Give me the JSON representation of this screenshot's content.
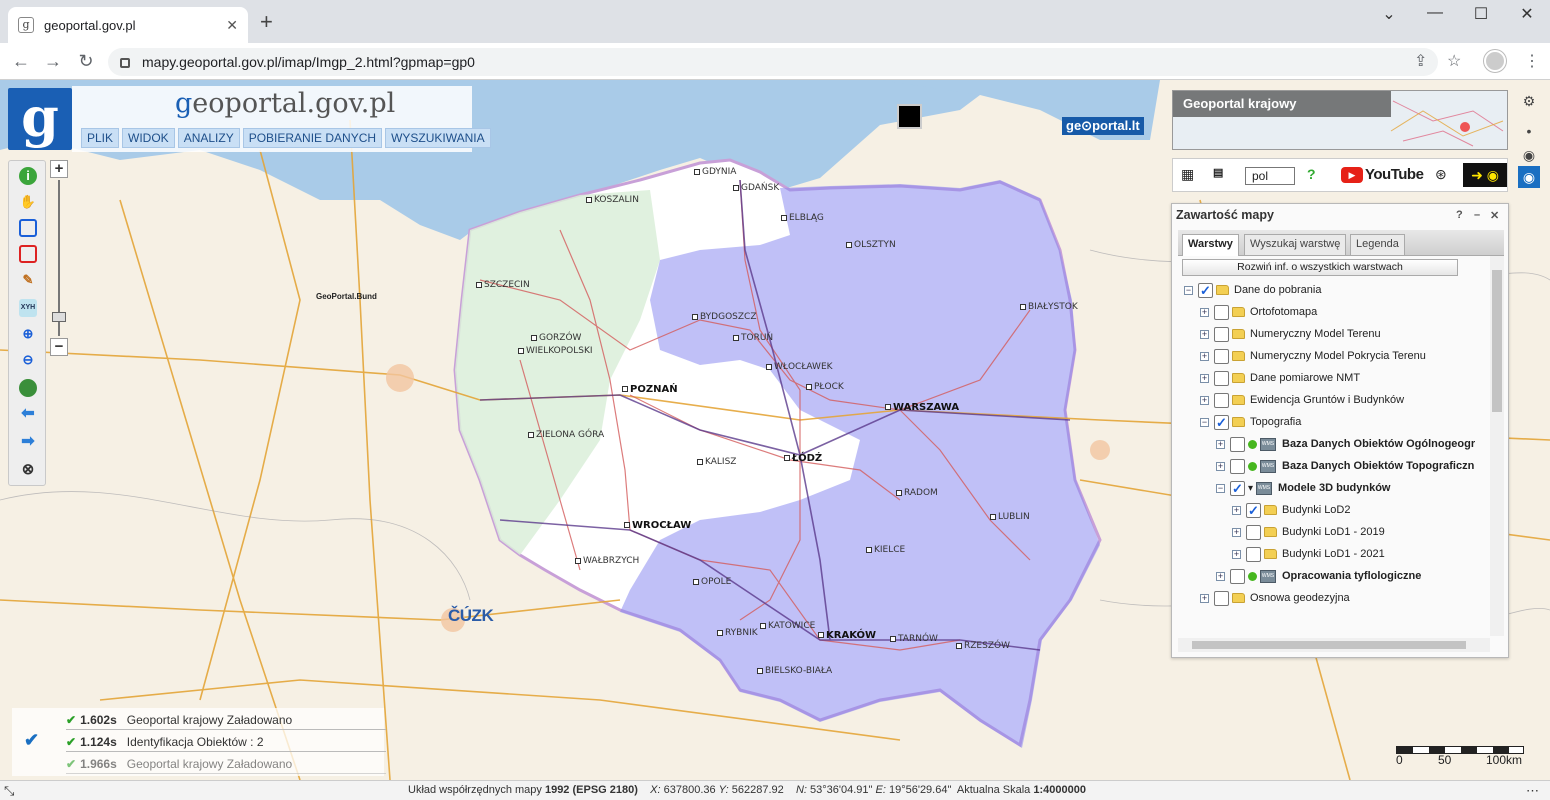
{
  "browser": {
    "tab_title": "geoportal.gov.pl",
    "tab_favicon": "g",
    "close_tab": "✕",
    "new_tab": "+",
    "url": "mapy.geoportal.gov.pl/imap/Imgp_2.html?gpmap=gp0"
  },
  "app": {
    "logo_letter": "g",
    "brand_pre": "g",
    "brand_main": "eoportal.gov.pl",
    "menu": [
      "PLIK",
      "WIDOK",
      "ANALIZY",
      "POBIERANIE DANYCH",
      "WYSZUKIWANIA"
    ],
    "toolbar_xyh": "XYH"
  },
  "minimap": {
    "label": "Geoportal krajowy"
  },
  "tools2": {
    "language": "pol"
  },
  "youtube": {
    "text": "YouTube"
  },
  "map_labels": {
    "gp_bund": "GeoPortal.Bund",
    "geoportal_lt": "ge⊙portal.lt",
    "cuzk": "ČÚZK",
    "cities": [
      {
        "name": "GDYNIA",
        "big": false
      },
      {
        "name": "GDAŃSK",
        "big": false
      },
      {
        "name": "KOSZALIN",
        "big": false
      },
      {
        "name": "ELBLĄG",
        "big": false
      },
      {
        "name": "OLSZTYN",
        "big": false
      },
      {
        "name": "SZCZECIN",
        "big": false
      },
      {
        "name": "BIAŁYSTOK",
        "big": false
      },
      {
        "name": "BYDGOSZCZ",
        "big": false
      },
      {
        "name": "TORUŃ",
        "big": false
      },
      {
        "name": "GORZÓW",
        "big": false
      },
      {
        "name": "WIELKOPOLSKI",
        "big": false
      },
      {
        "name": "WŁOCŁAWEK",
        "big": false
      },
      {
        "name": "PŁOCK",
        "big": false
      },
      {
        "name": "POZNAŃ",
        "big": true
      },
      {
        "name": "WARSZAWA",
        "big": true
      },
      {
        "name": "ZIELONA GÓRA",
        "big": false
      },
      {
        "name": "KALISZ",
        "big": false
      },
      {
        "name": "ŁÓDŹ",
        "big": true
      },
      {
        "name": "RADOM",
        "big": false
      },
      {
        "name": "LUBLIN",
        "big": false
      },
      {
        "name": "WROCŁAW",
        "big": true
      },
      {
        "name": "WAŁBRZYCH",
        "big": false
      },
      {
        "name": "KIELCE",
        "big": false
      },
      {
        "name": "OPOLE",
        "big": false
      },
      {
        "name": "RYBNIK",
        "big": false
      },
      {
        "name": "KATOWICE",
        "big": false
      },
      {
        "name": "KRAKÓW",
        "big": true
      },
      {
        "name": "TARNÓW",
        "big": false
      },
      {
        "name": "RZESZÓW",
        "big": false
      },
      {
        "name": "BIELSKO-BIAŁA",
        "big": false
      }
    ]
  },
  "panel": {
    "title": "Zawartość mapy",
    "help": "?",
    "minimize": "–",
    "close": "✕",
    "tabs": [
      "Warstwy",
      "Wyszukaj warstwę",
      "Legenda"
    ],
    "expand_all": "Rozwiń inf. o wszystkich warstwach",
    "layers": [
      {
        "label": "Dane do pobrania",
        "level": 0,
        "pm": "−",
        "checked": true,
        "type": "folder",
        "bold": false
      },
      {
        "label": "Ortofotomapa",
        "level": 1,
        "pm": "+",
        "checked": false,
        "type": "folder",
        "bold": false
      },
      {
        "label": "Numeryczny Model Terenu",
        "level": 1,
        "pm": "+",
        "checked": false,
        "type": "folder",
        "bold": false
      },
      {
        "label": "Numeryczny Model Pokrycia Terenu",
        "level": 1,
        "pm": "+",
        "checked": false,
        "type": "folder",
        "bold": false
      },
      {
        "label": "Dane pomiarowe NMT",
        "level": 1,
        "pm": "+",
        "checked": false,
        "type": "folder",
        "bold": false
      },
      {
        "label": "Ewidencja Gruntów i Budynków",
        "level": 1,
        "pm": "+",
        "checked": false,
        "type": "folder",
        "bold": false
      },
      {
        "label": "Topografia",
        "level": 1,
        "pm": "−",
        "checked": true,
        "type": "folder",
        "bold": false
      },
      {
        "label": "Baza Danych Obiektów Ogólnogeogr",
        "level": 2,
        "pm": "+",
        "checked": false,
        "type": "wms",
        "bold": true
      },
      {
        "label": "Baza Danych Obiektów Topograficzn",
        "level": 2,
        "pm": "+",
        "checked": false,
        "type": "wms",
        "bold": true
      },
      {
        "label": "Modele 3D budynków",
        "level": 2,
        "pm": "−",
        "checked": true,
        "type": "wms3d",
        "bold": true
      },
      {
        "label": "Budynki LoD2",
        "level": 3,
        "pm": "+",
        "checked": true,
        "type": "folder",
        "bold": false
      },
      {
        "label": "Budynki LoD1 - 2019",
        "level": 3,
        "pm": "+",
        "checked": false,
        "type": "folder",
        "bold": false
      },
      {
        "label": "Budynki LoD1 - 2021",
        "level": 3,
        "pm": "+",
        "checked": false,
        "type": "folder",
        "bold": false
      },
      {
        "label": "Opracowania tyflologiczne",
        "level": 2,
        "pm": "+",
        "checked": false,
        "type": "wms",
        "bold": true
      },
      {
        "label": "Osnowa geodezyjna",
        "level": 1,
        "pm": "+",
        "checked": false,
        "type": "folder",
        "bold": false
      }
    ]
  },
  "log": [
    {
      "time": "1.602s",
      "text": "Geoportal krajowy   Załadowano"
    },
    {
      "time": "1.124s",
      "text": "Identyfikacja   Obiektów : 2"
    },
    {
      "time": "1.966s",
      "text": "Geoportal krajowy   Załadowano"
    }
  ],
  "scale": {
    "zero": "0",
    "mid": "50",
    "max": "100km"
  },
  "status": {
    "crs_label": "Układ współrzędnych mapy",
    "crs_value": "1992 (EPSG 2180)",
    "x_label": "X:",
    "x_value": "637800.36",
    "y_label": "Y:",
    "y_value": "562287.92",
    "n_label": "N:",
    "n_value": "53°36'04.91\"",
    "e_label": "E:",
    "e_value": "19°56'29.64\"",
    "scale_label": "Aktualna Skala",
    "scale_value": "1:4000000"
  },
  "colors": {
    "accent": "#1a5fb4",
    "wms_highlight": "#8c8cf0",
    "sea": "#a9cbe8",
    "land": "#f6f0e4"
  }
}
